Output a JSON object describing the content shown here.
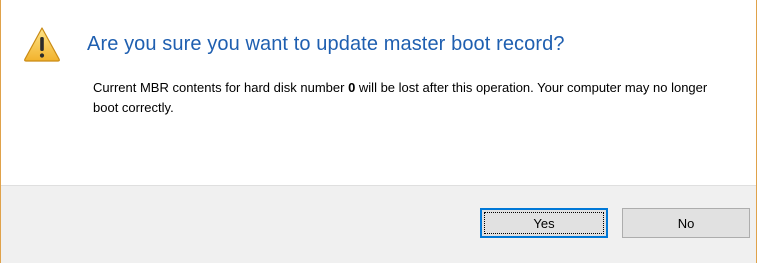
{
  "dialog": {
    "title": "Are you sure you want to update master boot record?",
    "message_before": "Current MBR contents for hard disk number ",
    "disk_number": "0",
    "message_after": " will be lost after this operation. Your computer may no longer boot correctly.",
    "icon": "warning-icon",
    "colors": {
      "title": "#1f5fb0",
      "accent_border": "#e0a24a",
      "default_button_border": "#0078d7"
    }
  },
  "buttons": {
    "yes_label": "Yes",
    "no_label": "No"
  }
}
